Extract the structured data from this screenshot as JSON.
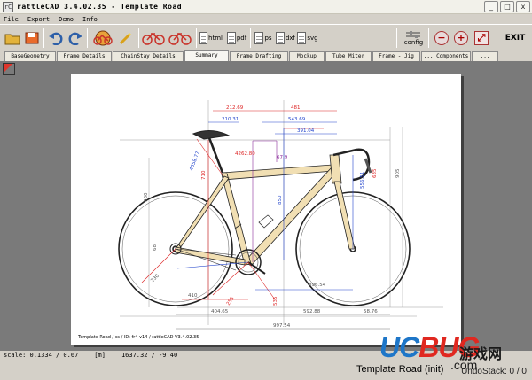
{
  "window": {
    "title": "rattleCAD  3.4.02.35 - Template Road",
    "app_icon_label": "rC",
    "minimize_glyph": "_",
    "maximize_glyph": "□",
    "close_glyph": "x"
  },
  "menu": {
    "items": [
      "File",
      "Export",
      "Demo",
      "Info"
    ]
  },
  "toolbar": {
    "html_label": "html",
    "pdf_label": "pdf",
    "ps_label": "ps",
    "dxf_label": "dxf",
    "svg_label": "svg",
    "config_label": "config",
    "zoom_out_glyph": "−",
    "zoom_in_glyph": "+",
    "fit_glyph": "⤢",
    "exit_label": "EXIT",
    "icon_colors": {
      "open": "#e3b33c",
      "accent": "#c9342b",
      "undo": "#2d5fa8"
    }
  },
  "tabs": [
    "BaseGeometry",
    "Frame Details",
    "ChainStay Details",
    "Summary",
    "Frame Drafting",
    "Mockup",
    "Tube Miter",
    "Frame - Jig",
    "... Components",
    "... info"
  ],
  "active_tab_index": 3,
  "drawing": {
    "dims_top": [
      "212.69",
      "481"
    ],
    "dims_mid": [
      "210.31",
      "543.69"
    ],
    "dim_reach": "391.04",
    "dim_stack": "4262.80",
    "dim_angle": "67.9",
    "dims_vertical": [
      "710",
      "980",
      "850",
      "556.51",
      "635",
      "905"
    ],
    "dims_left_small": [
      "4658.77",
      "68",
      "230"
    ],
    "dims_right_small": [
      "896.54"
    ],
    "dims_bottom_axis": [
      "410",
      "255",
      "535"
    ],
    "dims_bottom": [
      "404.65",
      "592.88",
      "58.76"
    ],
    "dim_wheelbase": "997.54",
    "footer": "Template Road   /   ss   /  ID: fr4 v14   /   rattleCAD  V3.4.02.35",
    "colors": {
      "frame": "#f1dfb3",
      "frame_stroke": "#222",
      "red": "#d22",
      "blue": "#2244cc",
      "purple": "#8a2a9a",
      "grey": "#777"
    }
  },
  "status": {
    "scale": "scale: 0.1334 / 0.67",
    "units": "[m]",
    "coords": "1637.32 / -9.40"
  },
  "status2": {
    "doc_title": "Template Road (init)",
    "undo_stack": "UndoStack:  0 / 0"
  },
  "watermark": {
    "brand_u": "UC",
    "brand_b": "BUG",
    "brand_cn": "游戏网",
    "domain": ".com"
  }
}
